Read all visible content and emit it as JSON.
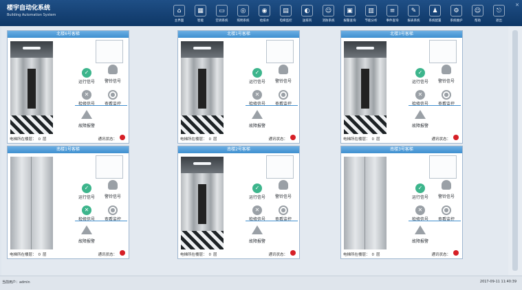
{
  "header": {
    "title": "楼宇自动化系统",
    "subtitle": "Building Automation System",
    "nav": [
      {
        "label": "主界面",
        "icon": "home-icon",
        "glyph": "⌂"
      },
      {
        "label": "智能",
        "icon": "keyboard-icon",
        "glyph": "▦"
      },
      {
        "label": "空调系统",
        "icon": "monitor-icon",
        "glyph": "▭"
      },
      {
        "label": "照明系统",
        "icon": "bulb-icon",
        "glyph": "◎"
      },
      {
        "label": "给排水",
        "icon": "gauge-icon",
        "glyph": "◉"
      },
      {
        "label": "电梯监控",
        "icon": "elevator-icon",
        "glyph": "▤"
      },
      {
        "label": "送排风",
        "icon": "fan-icon",
        "glyph": "◐"
      },
      {
        "label": "消防系统",
        "icon": "user-icon",
        "glyph": "☺"
      },
      {
        "label": "报警查询",
        "icon": "screen-icon",
        "glyph": "▣"
      },
      {
        "label": "节能分析",
        "icon": "folder-icon",
        "glyph": "▥"
      },
      {
        "label": "事件查询",
        "icon": "list-icon",
        "glyph": "≡"
      },
      {
        "label": "报表系统",
        "icon": "edit-icon",
        "glyph": "✎"
      },
      {
        "label": "系统配置",
        "icon": "person-icon",
        "glyph": "♟"
      },
      {
        "label": "系统维护",
        "icon": "gear-icon",
        "glyph": "⚙"
      },
      {
        "label": "帮助",
        "icon": "help-icon",
        "glyph": "☺"
      },
      {
        "label": "退出",
        "icon": "exit-icon",
        "glyph": "⎋"
      }
    ],
    "close": "×"
  },
  "elevators": [
    {
      "title": "北楼6号客梯",
      "door": "open",
      "floor_label": "电梯所在楼层：",
      "floor": "0",
      "floor_unit": "层",
      "comm_label": "通讯状态："
    },
    {
      "title": "北楼1号客梯",
      "door": "open",
      "floor_label": "电梯所在楼层：",
      "floor": "0",
      "floor_unit": "层",
      "comm_label": "通讯状态："
    },
    {
      "title": "北楼3号客梯",
      "door": "open",
      "floor_label": "电梯所在楼层：",
      "floor": "0",
      "floor_unit": "层",
      "comm_label": "通讯状态："
    },
    {
      "title": "南楼1号客梯",
      "door": "closed",
      "floor_label": "电梯所在楼层：",
      "floor": "0",
      "floor_unit": "层",
      "comm_label": "通讯状态："
    },
    {
      "title": "南楼2号客梯",
      "door": "open",
      "floor_label": "电梯所在楼层：",
      "floor": "0",
      "floor_unit": "层",
      "comm_label": "通讯状态："
    },
    {
      "title": "南楼3号客梯",
      "door": "closed",
      "floor_label": "电梯所在楼层：",
      "floor": "0",
      "floor_unit": "层",
      "comm_label": "通讯状态："
    }
  ],
  "signals": {
    "run": "运行信号",
    "alarm": "警铃信号",
    "maintain": "检修信号",
    "monitor": "查看监控",
    "fault": "故障报警"
  },
  "status": {
    "left": "当前用户：admin",
    "right": "2017-09-11  11:40:39"
  },
  "colors": {
    "header": "#0e3766",
    "card_title": "#3f8fcf",
    "signal_active": "#3db58c",
    "signal_inactive": "#9aa0a6",
    "comm_status": "#d61f26"
  }
}
